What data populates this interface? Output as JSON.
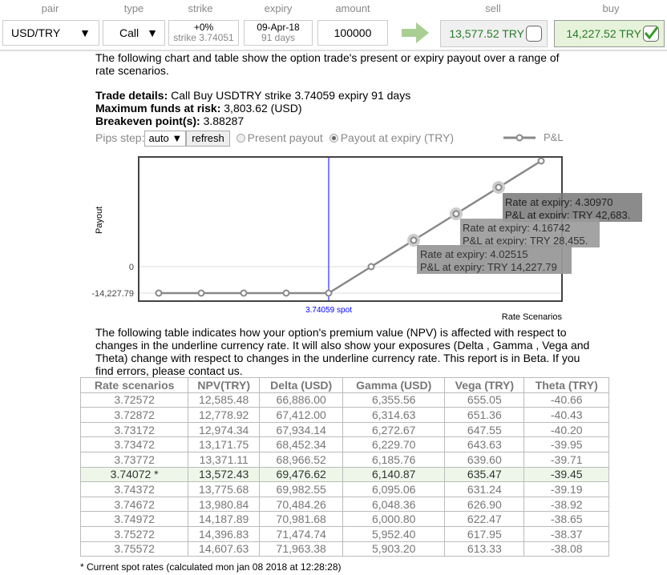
{
  "header": {
    "labels": {
      "pair": "pair",
      "type": "type",
      "strike": "strike",
      "expiry": "expiry",
      "amount": "amount",
      "sell": "sell",
      "buy": "buy"
    },
    "pair": "USD/TRY",
    "type": "Call",
    "strike_pct": "+0%",
    "strike_sub": "strike 3.74051",
    "expiry_date": "09-Apr-18",
    "expiry_days": "91 days",
    "amount": "100000",
    "sell_price": "13,577.52 TRY",
    "buy_price": "14,227.52 TRY",
    "dropdown_glyph": "▼"
  },
  "intro": "The following chart and table show the option trade's present or expiry payout over a range of rate scenarios.",
  "details": {
    "trade_label": "Trade details:",
    "trade_value": " Call Buy USDTRY strike 3.74059 expiry 91 days",
    "risk_label": "Maximum funds at risk:",
    "risk_value": " 3,803.62 (USD)",
    "be_label": "Breakeven point(s):",
    "be_value": " 3.88287"
  },
  "controls": {
    "pips_label": "Pips step:",
    "pips_value": "auto",
    "refresh": "refresh",
    "present": "Present payout",
    "expiry": "Payout at expiry (TRY)"
  },
  "chart_data": {
    "type": "line",
    "ylabel": "Payout",
    "xlabel": "Rate Scenarios",
    "legend": "P&L",
    "legend_position": "top-right",
    "yticks": [
      "0",
      "-14,227.79"
    ],
    "spot_label": "3.74059 spot",
    "spot": 3.74059,
    "x": [
      3.17147,
      3.31375,
      3.45603,
      3.59831,
      3.74059,
      3.88287,
      4.02515,
      4.16742,
      4.3097,
      4.45198
    ],
    "y": [
      -14227.79,
      -14227.79,
      -14227.79,
      -14227.79,
      -14227.79,
      0,
      14227.79,
      28455,
      42683,
      56911
    ],
    "tooltips": [
      {
        "l1": "Rate at expiry: 4.30970",
        "l2": "P&L at expiry: TRY 42,683."
      },
      {
        "l1": "Rate at expiry: 4.16742",
        "l2": "P&L at expiry: TRY 28,455."
      },
      {
        "l1": "Rate at expiry: 4.02515",
        "l2": "P&L at expiry: TRY 14,227.79"
      }
    ]
  },
  "table_intro": "The following table indicates how your option's premium value (NPV) is affected with respect to changes in the underline currency rate. It will also show your exposures (Delta , Gamma , Vega and Theta) change with respect to changes in the underline currency rate. This report is in Beta. If you find errors, please contact us.",
  "table": {
    "headers": [
      "Rate scenarios",
      "NPV(TRY)",
      "Delta (USD)",
      "Gamma (USD)",
      "Vega (TRY)",
      "Theta (TRY)"
    ],
    "rows": [
      [
        "3.72572",
        "12,585.48",
        "66,886.00",
        "6,355.56",
        "655.05",
        "-40.66"
      ],
      [
        "3.72872",
        "12,778.92",
        "67,412.00",
        "6,314.63",
        "651.36",
        "-40.43"
      ],
      [
        "3.73172",
        "12,974.34",
        "67,934.14",
        "6,272.67",
        "647.55",
        "-40.20"
      ],
      [
        "3.73472",
        "13,171.75",
        "68,452.34",
        "6,229.70",
        "643.63",
        "-39.95"
      ],
      [
        "3.73772",
        "13,371.11",
        "68,966.52",
        "6,185.76",
        "639.60",
        "-39.71"
      ],
      [
        "3.74072 *",
        "13,572.43",
        "69,476.62",
        "6,140.87",
        "635.47",
        "-39.45"
      ],
      [
        "3.74372",
        "13,775.68",
        "69,982.55",
        "6,095.06",
        "631.24",
        "-39.19"
      ],
      [
        "3.74672",
        "13,980.84",
        "70,484.26",
        "6,048.36",
        "626.90",
        "-38.92"
      ],
      [
        "3.74972",
        "14,187.89",
        "70,981.68",
        "6,000.80",
        "622.47",
        "-38.65"
      ],
      [
        "3.75272",
        "14,396.83",
        "71,474.74",
        "5,952.40",
        "617.95",
        "-38.37"
      ],
      [
        "3.75572",
        "14,607.63",
        "71,963.38",
        "5,903.20",
        "613.33",
        "-38.08"
      ]
    ],
    "highlight_row": 5
  },
  "footnote": "* Current spot rates (calculated mon jan 08 2018 at 12:28:28)"
}
